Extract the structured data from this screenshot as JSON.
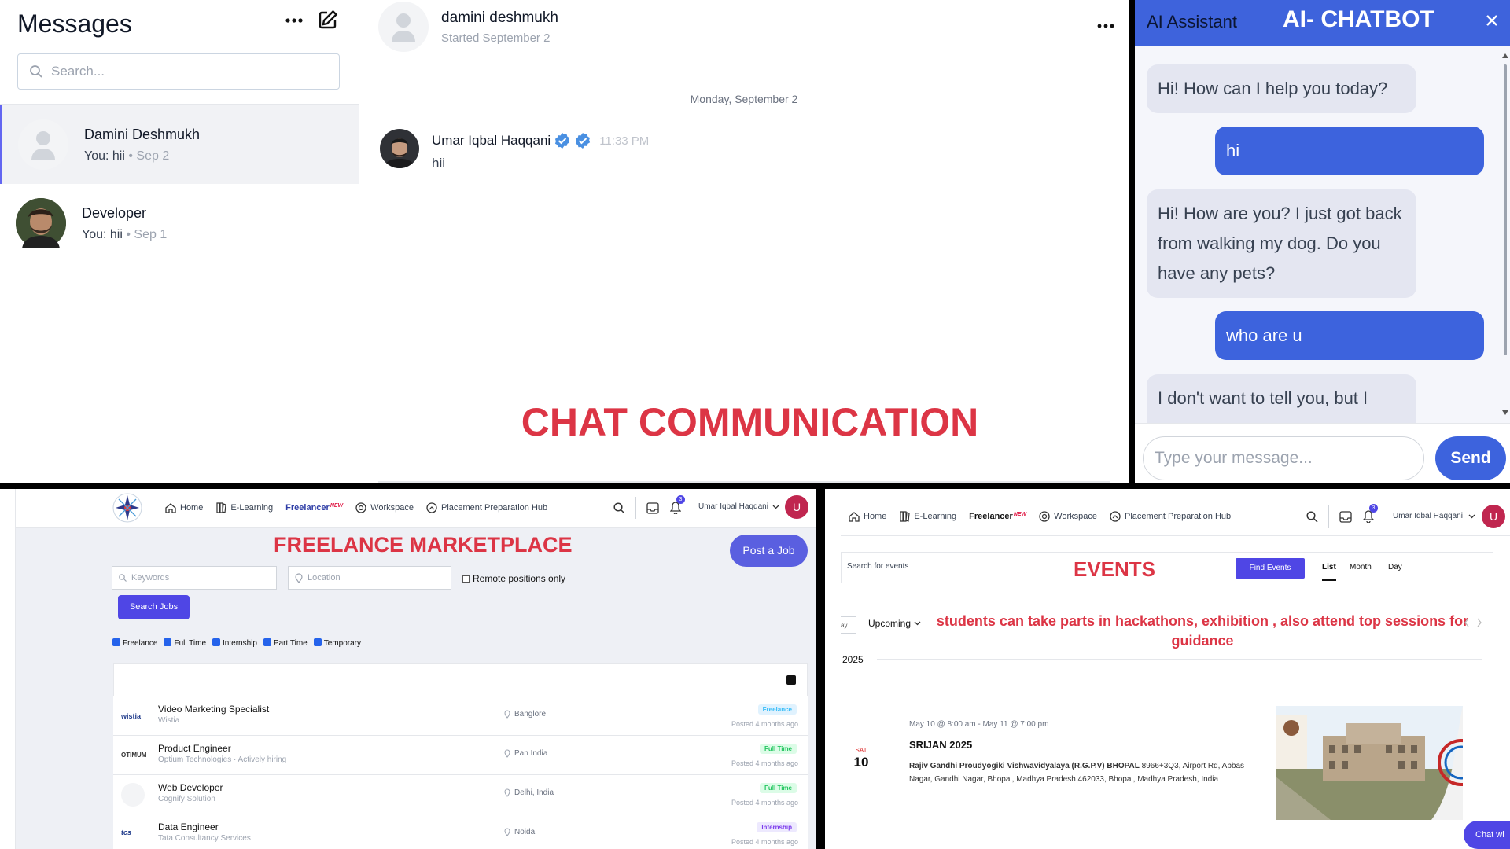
{
  "messages": {
    "title": "Messages",
    "search_placeholder": "Search...",
    "conversations": [
      {
        "name": "Damini Deshmukh",
        "preview": "You: hii",
        "date": "Sep 2"
      },
      {
        "name": "Developer",
        "preview": "You: hii",
        "date": "Sep 1"
      }
    ]
  },
  "chat": {
    "contact_name": "damini deshmukh",
    "started": "Started September 2",
    "day_label": "Monday, September 2",
    "message": {
      "sender": "Umar Iqbal Haqqani",
      "time": "11:33 PM",
      "text": "hii"
    },
    "overlay": "CHAT COMMUNICATION"
  },
  "ai": {
    "title": "AI Assistant",
    "overlay": "AI- CHATBOT",
    "messages": [
      {
        "role": "bot",
        "text": "Hi! How can I help you today?"
      },
      {
        "role": "user",
        "text": "hi"
      },
      {
        "role": "bot",
        "text": "Hi! How are you? I just got back from walking my dog. Do you have any pets?"
      },
      {
        "role": "user",
        "text": "who are u"
      },
      {
        "role": "bot",
        "text": "I don't want to tell you, but I"
      }
    ],
    "input_placeholder": "Type your message...",
    "send": "Send"
  },
  "freelance": {
    "nav": [
      "Home",
      "E-Learning",
      "Workspace",
      "Placement Preparation Hub"
    ],
    "freelancer_label": "Freelancer",
    "new_badge": "NEW",
    "notification_count": "3",
    "user_name": "Umar Iqbal Haqqani",
    "user_initial": "U",
    "overlay": "FREELANCE MARKETPLACE",
    "post_job": "Post a Job",
    "keywords_placeholder": "Keywords",
    "location_placeholder": "Location",
    "remote_label": "Remote positions only",
    "search_button": "Search Jobs",
    "filters": [
      "Freelance",
      "Full Time",
      "Internship",
      "Part Time",
      "Temporary"
    ],
    "jobs": [
      {
        "title": "Video Marketing Specialist",
        "company": "Wistia",
        "logo": "wistia",
        "location": "Banglore",
        "type": "Freelance",
        "posted": "Posted 4 months ago"
      },
      {
        "title": "Product Engineer",
        "company": "Optium Technologies · Actively hiring",
        "logo": "OTIMUM",
        "location": "Pan India",
        "type": "Full Time",
        "posted": "Posted 4 months ago"
      },
      {
        "title": "Web Developer",
        "company": "Cognify Solution",
        "logo": "",
        "location": "Delhi, India",
        "type": "Full Time",
        "posted": "Posted 4 months ago"
      },
      {
        "title": "Data Engineer",
        "company": "Tata Consultancy Services",
        "logo": "tcs",
        "location": "Noida",
        "type": "Internship",
        "posted": "Posted 4 months ago"
      }
    ]
  },
  "events": {
    "nav": [
      "Home",
      "E-Learning",
      "Workspace",
      "Placement Preparation Hub"
    ],
    "freelancer_label": "Freelancer",
    "new_badge": "NEW",
    "notification_count": "3",
    "user_name": "Umar Iqbal Haqqani",
    "user_initial": "U",
    "search_placeholder": "Search for events",
    "overlay": "EVENTS",
    "find_button": "Find Events",
    "views": [
      "List",
      "Month",
      "Day"
    ],
    "today_btn": "ay",
    "upcoming": "Upcoming",
    "description": "students can take parts in hackathons, exhibition , also attend top sessions for guidance",
    "year": "2025",
    "event": {
      "day_name": "SAT",
      "day_num": "10",
      "datetime": "May 10 @ 8:00 am - May 11 @ 7:00 pm",
      "title": "SRIJAN 2025",
      "venue": "Rajiv Gandhi Proudyogiki Vishwavidyalaya (R.G.P.V) BHOPAL",
      "address": "8966+3Q3, Airport Rd, Abbas Nagar, Gandhi Nagar, Bhopal, Madhya Pradesh 462033, Bhopal, Madhya Pradesh, India"
    },
    "chat_widget": "Chat wi"
  },
  "colors": {
    "accent": "#4f46e5",
    "chat_blue": "#3d63dd",
    "overlay_red": "#dc3545"
  }
}
